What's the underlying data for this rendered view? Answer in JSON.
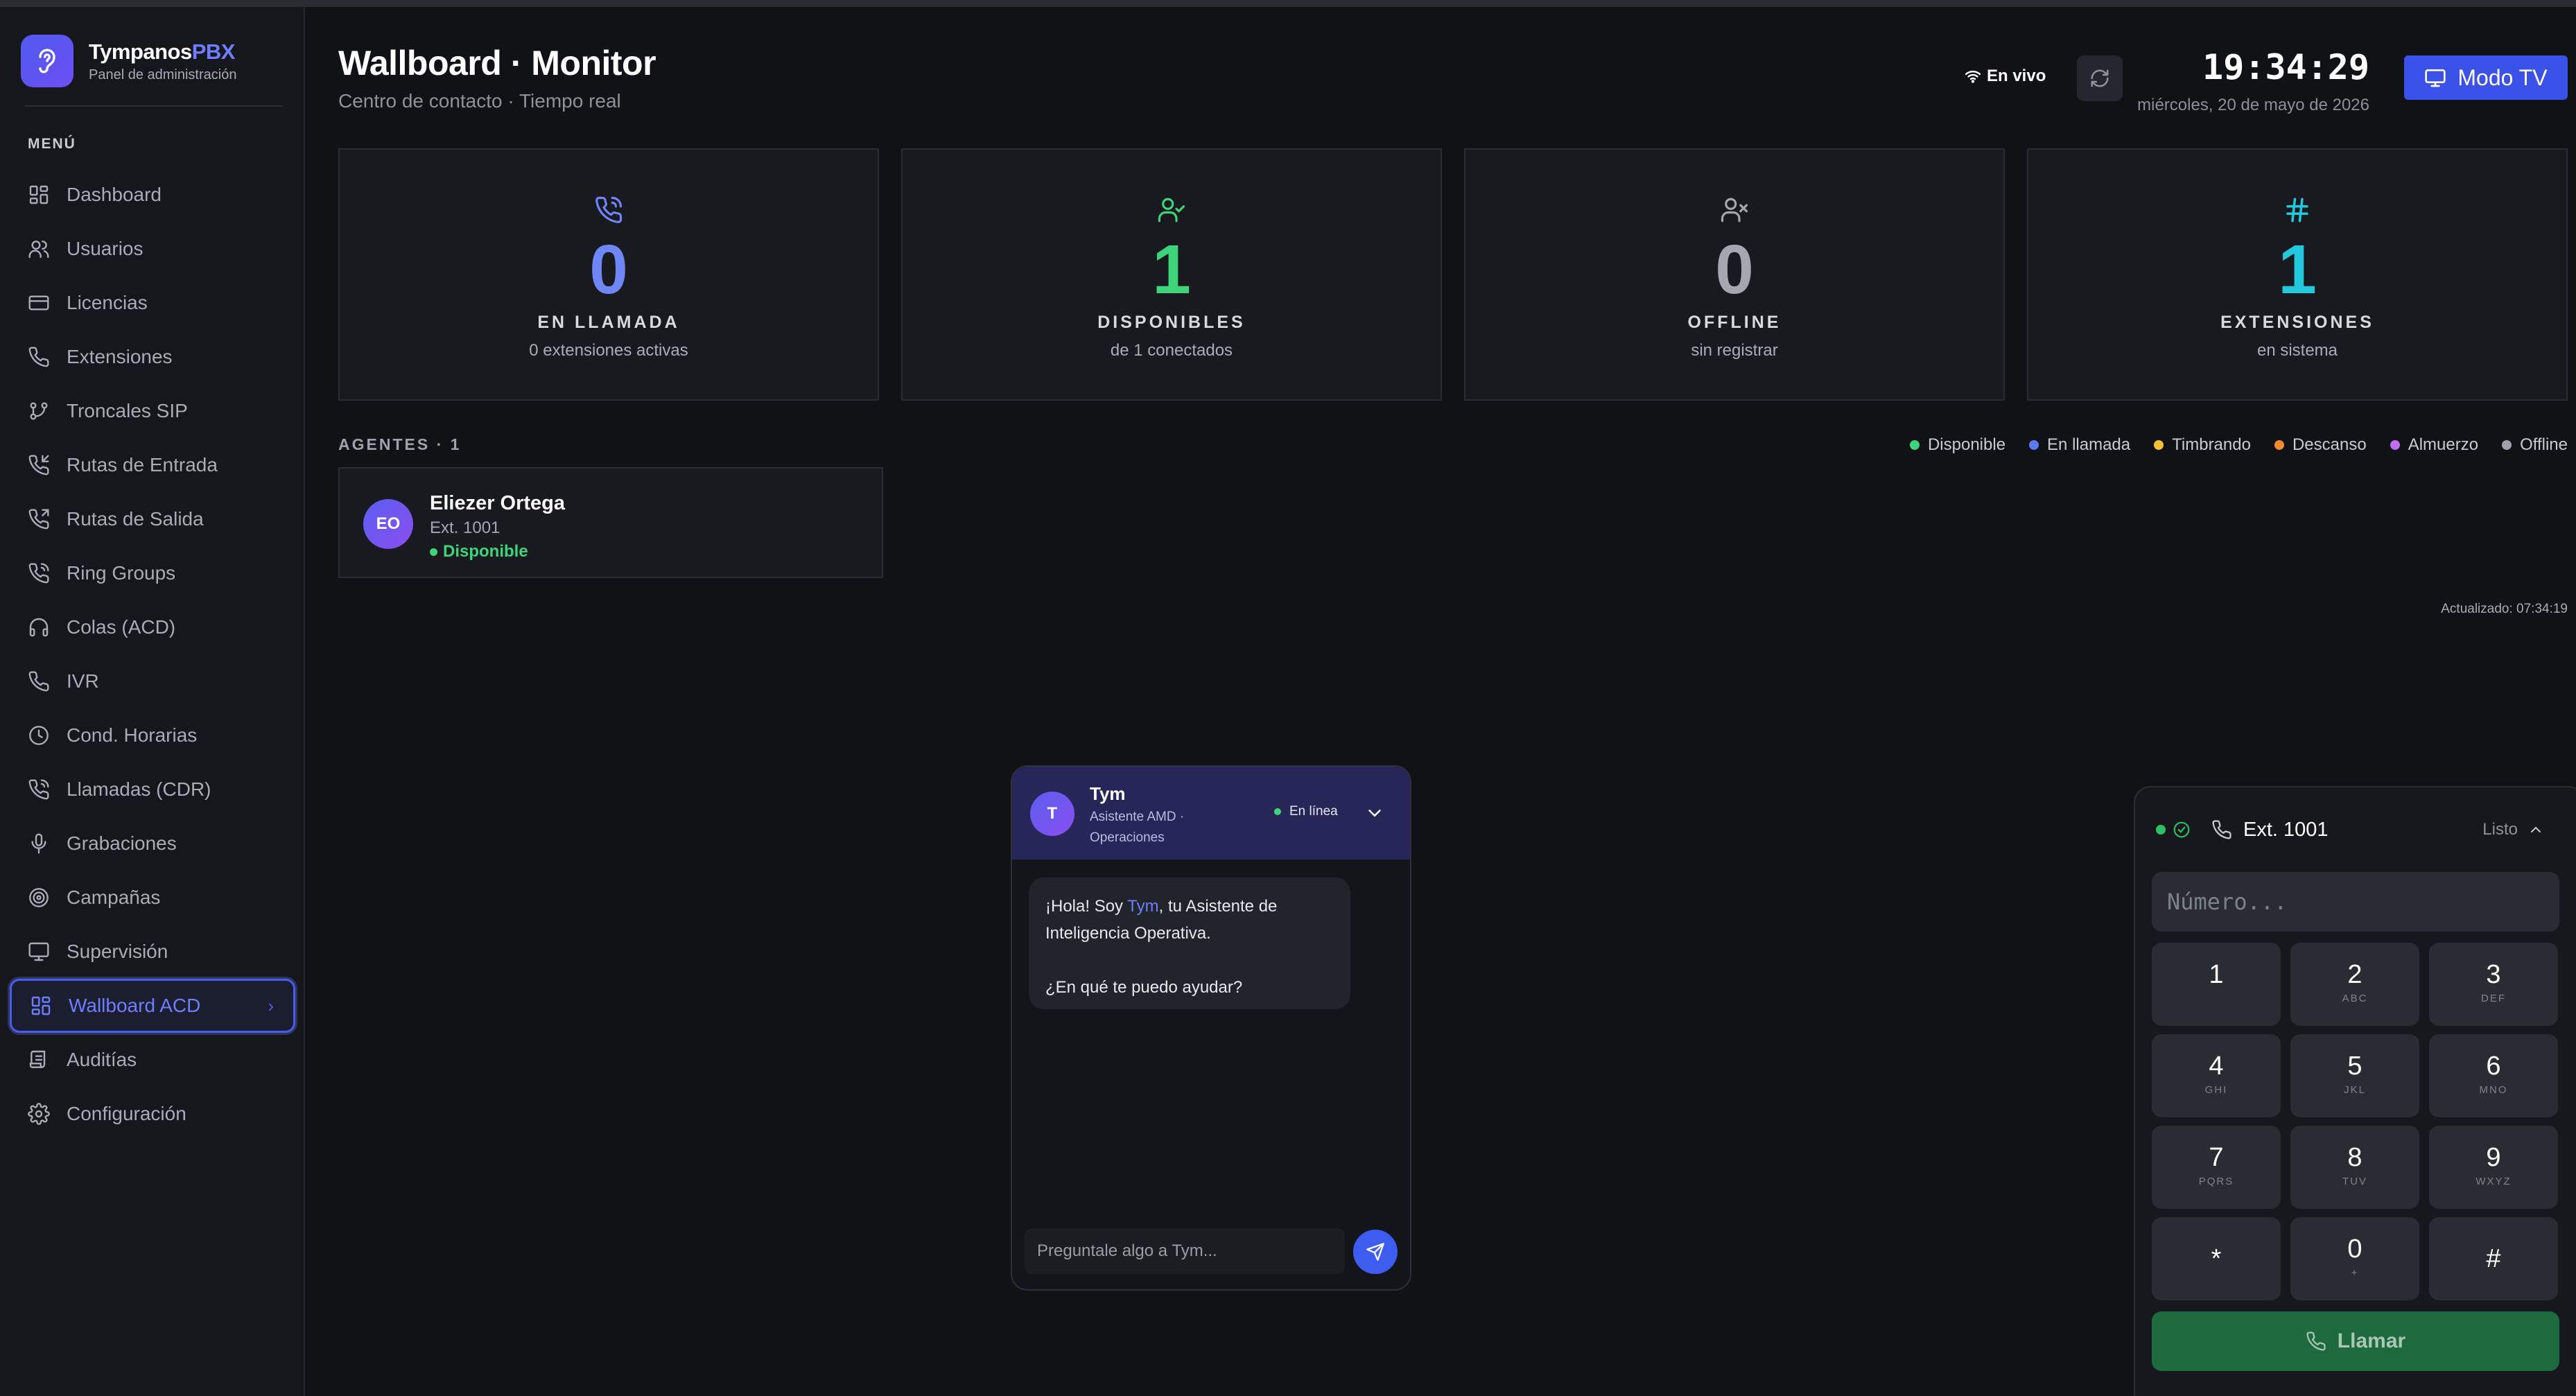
{
  "brand": {
    "name_main": "Tympanos",
    "name_accent": "PBX",
    "subtitle": "Panel de administración"
  },
  "sidebar": {
    "menu_title": "MENÚ",
    "items": [
      {
        "label": "Dashboard",
        "icon": "grid-icon"
      },
      {
        "label": "Usuarios",
        "icon": "users-icon"
      },
      {
        "label": "Licencias",
        "icon": "card-icon"
      },
      {
        "label": "Extensiones",
        "icon": "phone-icon"
      },
      {
        "label": "Troncales SIP",
        "icon": "branch-icon"
      },
      {
        "label": "Rutas de Entrada",
        "icon": "phone-incoming-icon"
      },
      {
        "label": "Rutas de Salida",
        "icon": "phone-outgoing-icon"
      },
      {
        "label": "Ring Groups",
        "icon": "phone-call-icon"
      },
      {
        "label": "Colas (ACD)",
        "icon": "headphones-icon"
      },
      {
        "label": "IVR",
        "icon": "phone-icon"
      },
      {
        "label": "Cond. Horarias",
        "icon": "clock-icon"
      },
      {
        "label": "Llamadas (CDR)",
        "icon": "phone-call-icon"
      },
      {
        "label": "Grabaciones",
        "icon": "mic-icon"
      },
      {
        "label": "Campañas",
        "icon": "target-icon"
      },
      {
        "label": "Supervisión",
        "icon": "monitor-icon"
      },
      {
        "label": "Wallboard ACD",
        "icon": "grid-icon",
        "active": true
      },
      {
        "label": "Auditías",
        "icon": "scroll-icon"
      },
      {
        "label": "Configuración",
        "icon": "gear-icon"
      }
    ]
  },
  "header": {
    "title": "Wallboard · Monitor",
    "subtitle": "Centro de contacto · Tiempo real",
    "live_label": "En vivo",
    "clock": "19:34:29",
    "date": "miércoles, 20 de mayo de 2026",
    "tv_button": "Modo TV"
  },
  "stats": [
    {
      "value": "0",
      "label": "EN LLAMADA",
      "sub": "0 extensiones activas",
      "color": "#6f86f7",
      "icon": "phone-call-icon"
    },
    {
      "value": "1",
      "label": "DISPONIBLES",
      "sub": "de 1 conectados",
      "color": "#3ed57a",
      "icon": "user-check-icon"
    },
    {
      "value": "0",
      "label": "OFFLINE",
      "sub": "sin registrar",
      "color": "#a4a7b0",
      "icon": "user-x-icon"
    },
    {
      "value": "1",
      "label": "EXTENSIONES",
      "sub": "en sistema",
      "color": "#22c9dd",
      "icon": "hash-icon"
    }
  ],
  "agents": {
    "title": "AGENTES · 1",
    "list": [
      {
        "initials": "EO",
        "name": "Eliezer Ortega",
        "ext": "Ext. 1001",
        "status": "Disponible"
      }
    ]
  },
  "legend": [
    {
      "label": "Disponible",
      "color": "#3ed57a"
    },
    {
      "label": "En llamada",
      "color": "#5b7cf5"
    },
    {
      "label": "Timbrando",
      "color": "#f2c230"
    },
    {
      "label": "Descanso",
      "color": "#f28a30"
    },
    {
      "label": "Almuerzo",
      "color": "#c06cf2"
    },
    {
      "label": "Offline",
      "color": "#9ea2ad"
    }
  ],
  "updated": "Actualizado: 07:34:19",
  "chat": {
    "avatar": "T",
    "name": "Tym",
    "role": "Asistente AMD · Operaciones",
    "status": "En línea",
    "greeting_pre": "¡Hola! Soy ",
    "greeting_name": "Tym",
    "greeting_post": ", tu Asistente de Inteligencia Operativa.",
    "question": "¿En qué te puedo ayudar?",
    "input_placeholder": "Preguntale algo a Tym..."
  },
  "dialer": {
    "ext": "Ext. 1001",
    "status": "Listo",
    "number_placeholder": "Número...",
    "keys": [
      {
        "d": "1",
        "l": ""
      },
      {
        "d": "2",
        "l": "ABC"
      },
      {
        "d": "3",
        "l": "DEF"
      },
      {
        "d": "4",
        "l": "GHI"
      },
      {
        "d": "5",
        "l": "JKL"
      },
      {
        "d": "6",
        "l": "MNO"
      },
      {
        "d": "7",
        "l": "PQRS"
      },
      {
        "d": "8",
        "l": "TUV"
      },
      {
        "d": "9",
        "l": "WXYZ"
      },
      {
        "d": "*",
        "l": ""
      },
      {
        "d": "0",
        "l": "+"
      },
      {
        "d": "#",
        "l": ""
      }
    ],
    "call_label": "Llamar"
  }
}
